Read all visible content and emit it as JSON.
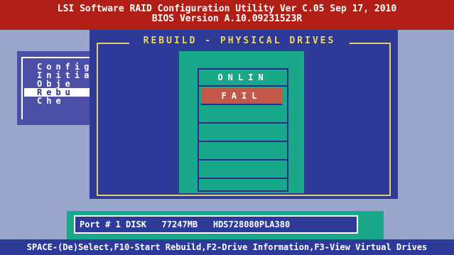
{
  "header": {
    "line1": "LSI Software RAID Configuration Utility Ver C.05 Sep 17, 2010",
    "line2": "BIOS Version   A.10.09231523R"
  },
  "main_menu": {
    "items": [
      {
        "label": "Config"
      },
      {
        "label": "Initia"
      },
      {
        "label": "Obje"
      },
      {
        "label": "Rebu"
      },
      {
        "label": "Che"
      }
    ],
    "selected_index": 3
  },
  "dialog": {
    "title": "REBUILD - PHYSICAL DRIVES",
    "slots": [
      "ONLIN",
      "FAIL",
      "",
      "",
      "",
      ""
    ]
  },
  "info_bar": {
    "text": "Port # 1 DISK   77247MB   HDS728080PLA380"
  },
  "footer": {
    "text": "SPACE-(De)Select,F10-Start Rebuild,F2-Drive Information,F3-View Virtual Drives"
  },
  "colors": {
    "header_bg": "#b01e16",
    "dialog_bg": "#2e3a97",
    "panel_teal": "#1aa88a",
    "fail_highlight": "#c2584a",
    "title_yellow": "#f0d460"
  }
}
